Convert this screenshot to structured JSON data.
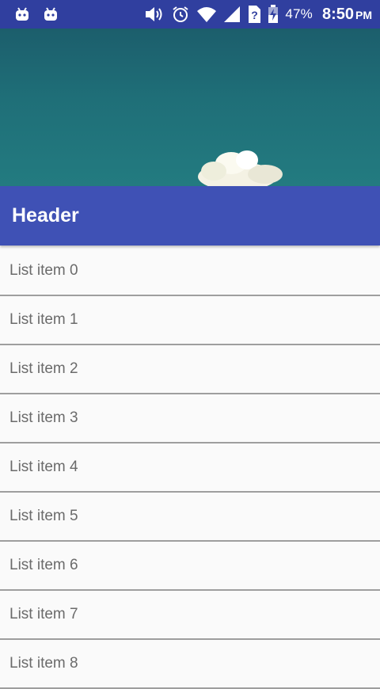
{
  "status_bar": {
    "left_icons": [
      "android-icon",
      "android-icon"
    ],
    "right_icons": [
      "volume-icon",
      "alarm-icon",
      "wifi-icon",
      "signal-icon",
      "no-sim-icon",
      "battery-charging-icon"
    ],
    "battery_percent": "47%",
    "time": "8:50",
    "ampm": "PM",
    "color": "#303f9f"
  },
  "hero": {
    "description_icon": "sky-cloud-image"
  },
  "header": {
    "title": "Header",
    "color": "#3f51b5"
  },
  "list": {
    "items": [
      {
        "label": "List item 0"
      },
      {
        "label": "List item 1"
      },
      {
        "label": "List item 2"
      },
      {
        "label": "List item 3"
      },
      {
        "label": "List item 4"
      },
      {
        "label": "List item 5"
      },
      {
        "label": "List item 6"
      },
      {
        "label": "List item 7"
      },
      {
        "label": "List item 8"
      }
    ]
  }
}
